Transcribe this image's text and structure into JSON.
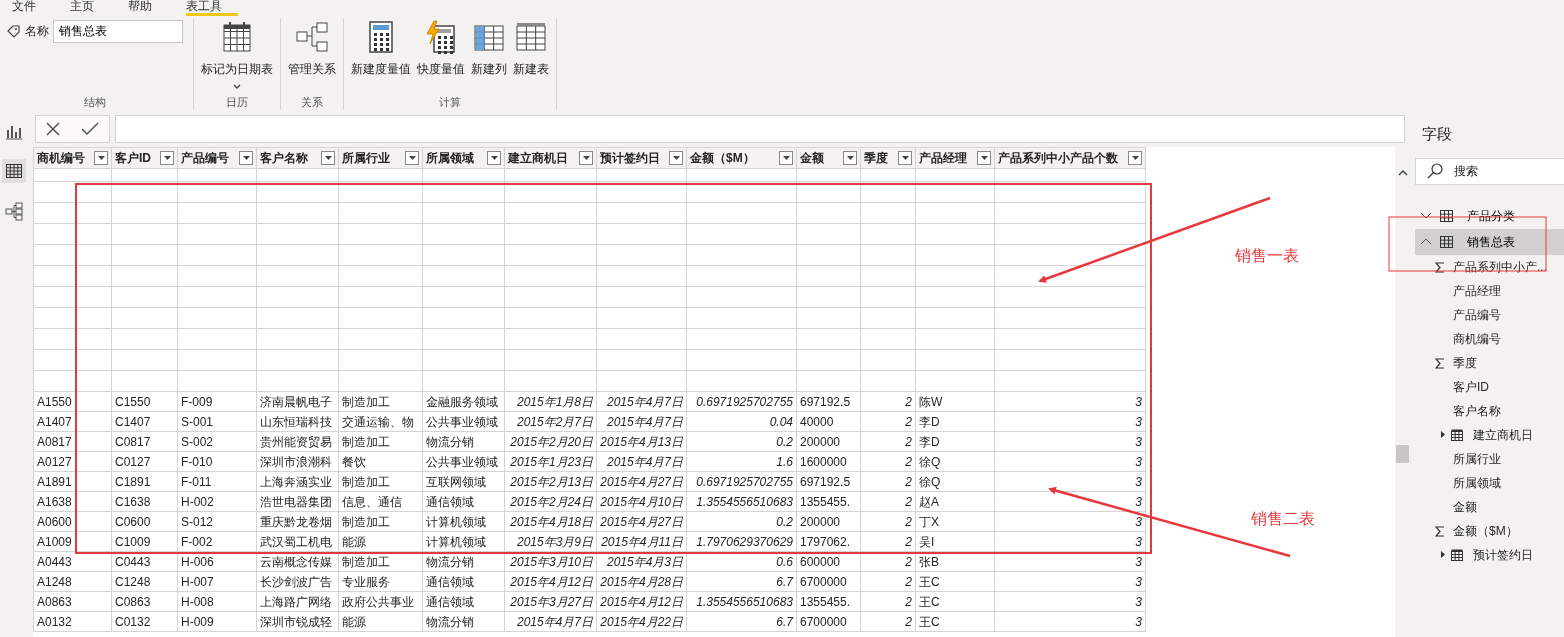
{
  "ribbon_tabs": [
    {
      "label": "文件",
      "selected": false
    },
    {
      "label": "主页",
      "selected": false
    },
    {
      "label": "帮助",
      "selected": false
    },
    {
      "label": "表工具",
      "selected": true
    }
  ],
  "ribbon": {
    "name_label": "名称",
    "name_value": "销售总表",
    "groups": [
      {
        "label": "结构",
        "kind": "name"
      },
      {
        "label": "日历",
        "kind": "buttons",
        "buttons": [
          {
            "label": "标记为日期表",
            "dropdown": true
          }
        ]
      },
      {
        "label": "关系",
        "kind": "buttons",
        "buttons": [
          {
            "label": "管理关系",
            "dropdown": false
          }
        ]
      },
      {
        "label": "计算",
        "kind": "buttons",
        "buttons": [
          {
            "label": "新建度量值",
            "dropdown": false
          },
          {
            "label": "快度量值",
            "dropdown": false
          },
          {
            "label": "新建列",
            "dropdown": false
          },
          {
            "label": "新建表",
            "dropdown": false
          }
        ]
      }
    ]
  },
  "views": [
    {
      "kind": "report",
      "selected": false
    },
    {
      "kind": "data",
      "selected": true
    },
    {
      "kind": "model",
      "selected": false
    }
  ],
  "table": {
    "columns": [
      {
        "label": "商机编号",
        "kind": "text"
      },
      {
        "label": "客户ID",
        "kind": "text"
      },
      {
        "label": "产品编号",
        "kind": "text"
      },
      {
        "label": "客户名称",
        "kind": "text"
      },
      {
        "label": "所属行业",
        "kind": "text"
      },
      {
        "label": "所属领域",
        "kind": "text"
      },
      {
        "label": "建立商机日",
        "kind": "date"
      },
      {
        "label": "预计签约日",
        "kind": "date"
      },
      {
        "label": "金额（$M）",
        "kind": "number"
      },
      {
        "label": "金额",
        "kind": "text"
      },
      {
        "label": "季度",
        "kind": "number"
      },
      {
        "label": "产品经理",
        "kind": "text"
      },
      {
        "label": "产品系列中小产品个数",
        "kind": "number"
      }
    ],
    "rows": [
      {
        "blank": true
      },
      {
        "blank": true
      },
      {
        "blank": true
      },
      {
        "blank": true
      },
      {
        "blank": true
      },
      {
        "blank": true
      },
      {
        "blank": true
      },
      {
        "blank": true
      },
      {
        "blank": true
      },
      {
        "blank": true
      },
      {
        "blank": true
      },
      {
        "blank": false,
        "cells": [
          "A1550",
          "C1550",
          "F-009",
          "济南晨帆电子",
          "制造加工",
          "金融服务领域",
          "2015年1月8日",
          "2015年4月7日",
          "0.6971925702755",
          "697192.5",
          "2",
          "陈W",
          "3"
        ]
      },
      {
        "blank": false,
        "cells": [
          "A1407",
          "C1407",
          "S-001",
          "山东恒瑞科技",
          "交通运输、物",
          "公共事业领域",
          "2015年2月7日",
          "2015年4月7日",
          "0.04",
          "40000",
          "2",
          "李D",
          "3"
        ]
      },
      {
        "blank": false,
        "cells": [
          "A0817",
          "C0817",
          "S-002",
          "贵州能资贸易",
          "制造加工",
          "物流分销",
          "2015年2月20日",
          "2015年4月13日",
          "0.2",
          "200000",
          "2",
          "李D",
          "3"
        ]
      },
      {
        "blank": false,
        "cells": [
          "A0127",
          "C0127",
          "F-010",
          "深圳市浪潮科",
          "餐饮",
          "公共事业领域",
          "2015年1月23日",
          "2015年4月7日",
          "1.6",
          "1600000",
          "2",
          "徐Q",
          "3"
        ]
      },
      {
        "blank": false,
        "cells": [
          "A1891",
          "C1891",
          "F-011",
          "上海奔涵实业",
          "制造加工",
          "互联网领域",
          "2015年2月13日",
          "2015年4月27日",
          "0.6971925702755",
          "697192.5",
          "2",
          "徐Q",
          "3"
        ]
      },
      {
        "blank": false,
        "cells": [
          "A1638",
          "C1638",
          "H-002",
          "浩世电器集团",
          "信息、通信",
          "通信领域",
          "2015年2月24日",
          "2015年4月10日",
          "1.3554556510683",
          "1355455.",
          "2",
          "赵A",
          "3"
        ]
      },
      {
        "blank": false,
        "cells": [
          "A0600",
          "C0600",
          "S-012",
          "重庆黔龙卷烟",
          "制造加工",
          "计算机领域",
          "2015年4月18日",
          "2015年4月27日",
          "0.2",
          "200000",
          "2",
          "丁X",
          "3"
        ]
      },
      {
        "blank": false,
        "cells": [
          "A1009",
          "C1009",
          "F-002",
          "武汉蜀工机电",
          "能源",
          "计算机领域",
          "2015年3月9日",
          "2015年4月11日",
          "1.7970629370629",
          "1797062.",
          "2",
          "吴I",
          "3"
        ]
      },
      {
        "blank": false,
        "cells": [
          "A0443",
          "C0443",
          "H-006",
          "云南概念传媒",
          "制造加工",
          "物流分销",
          "2015年3月10日",
          "2015年4月3日",
          "0.6",
          "600000",
          "2",
          "张B",
          "3"
        ]
      },
      {
        "blank": false,
        "cells": [
          "A1248",
          "C1248",
          "H-007",
          "长沙剑波广告",
          "专业服务",
          "通信领域",
          "2015年4月12日",
          "2015年4月28日",
          "6.7",
          "6700000",
          "2",
          "王C",
          "3"
        ]
      },
      {
        "blank": false,
        "cells": [
          "A0863",
          "C0863",
          "H-008",
          "上海路广网络",
          "政府公共事业",
          "通信领域",
          "2015年3月27日",
          "2015年4月12日",
          "1.3554556510683",
          "1355455.",
          "2",
          "王C",
          "3"
        ]
      },
      {
        "blank": false,
        "cells": [
          "A0132",
          "C0132",
          "H-009",
          "深圳市锐成轻",
          "能源",
          "物流分销",
          "2015年4月7日",
          "2015年4月22日",
          "6.7",
          "6700000",
          "2",
          "王C",
          "3"
        ]
      }
    ]
  },
  "fields": {
    "title": "字段",
    "search_placeholder": "搜索",
    "tables": [
      {
        "name": "产品分类",
        "expanded": false,
        "selected": false
      },
      {
        "name": "销售总表",
        "expanded": true,
        "selected": true,
        "children": [
          {
            "name": "产品系列中小产...",
            "kind": "measure"
          },
          {
            "name": "产品经理",
            "kind": "plain"
          },
          {
            "name": "产品编号",
            "kind": "plain"
          },
          {
            "name": "商机编号",
            "kind": "plain"
          },
          {
            "name": "季度",
            "kind": "measure"
          },
          {
            "name": "客户ID",
            "kind": "plain"
          },
          {
            "name": "客户名称",
            "kind": "plain"
          },
          {
            "name": "建立商机日",
            "kind": "date"
          },
          {
            "name": "所属行业",
            "kind": "plain"
          },
          {
            "name": "所属领域",
            "kind": "plain"
          },
          {
            "name": "金额",
            "kind": "plain"
          },
          {
            "name": "金额（$M）",
            "kind": "measure"
          },
          {
            "name": "预计签约日",
            "kind": "date"
          }
        ]
      }
    ]
  },
  "annotations": [
    {
      "text": "销售一表"
    },
    {
      "text": "销售二表"
    }
  ]
}
